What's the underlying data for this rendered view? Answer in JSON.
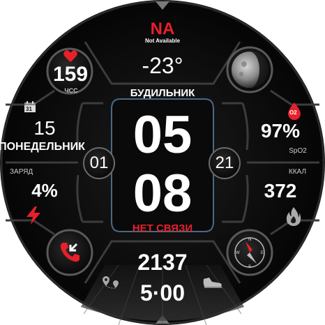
{
  "weather": {
    "status": "NA",
    "status_sub": "Not Available",
    "temperature": "-23°"
  },
  "heart_rate": {
    "value": "159",
    "label": "ЧСС"
  },
  "date": {
    "day": "15",
    "weekday": "ПОНЕДЕЛЬНИК",
    "calendar_icon_num": "31"
  },
  "battery": {
    "label": "ЗАРЯД",
    "value": "4%"
  },
  "alarm": {
    "label": "БУДИЛЬНИК"
  },
  "time": {
    "hours": "05",
    "minutes": "08",
    "seconds": "21",
    "side_left": "01"
  },
  "connection": {
    "status": "НЕТ СВЯЗИ"
  },
  "spo2": {
    "value": "97%",
    "label": "SpO2",
    "badge": "O2"
  },
  "calories": {
    "label": "ККАЛ",
    "value": "372"
  },
  "steps": {
    "value": "2137",
    "distance": "5·00"
  },
  "colors": {
    "accent_red": "#e8202a",
    "bg": "#0b0b0b",
    "frame": "#3a3a3a",
    "glass": "#5a6a7a"
  },
  "icons": [
    "heart-icon",
    "calendar-icon",
    "lightning-icon",
    "phone-missed-icon",
    "moon-icon",
    "oxygen-icon",
    "flame-icon",
    "compass-icon",
    "location-icon",
    "shoe-icon"
  ]
}
